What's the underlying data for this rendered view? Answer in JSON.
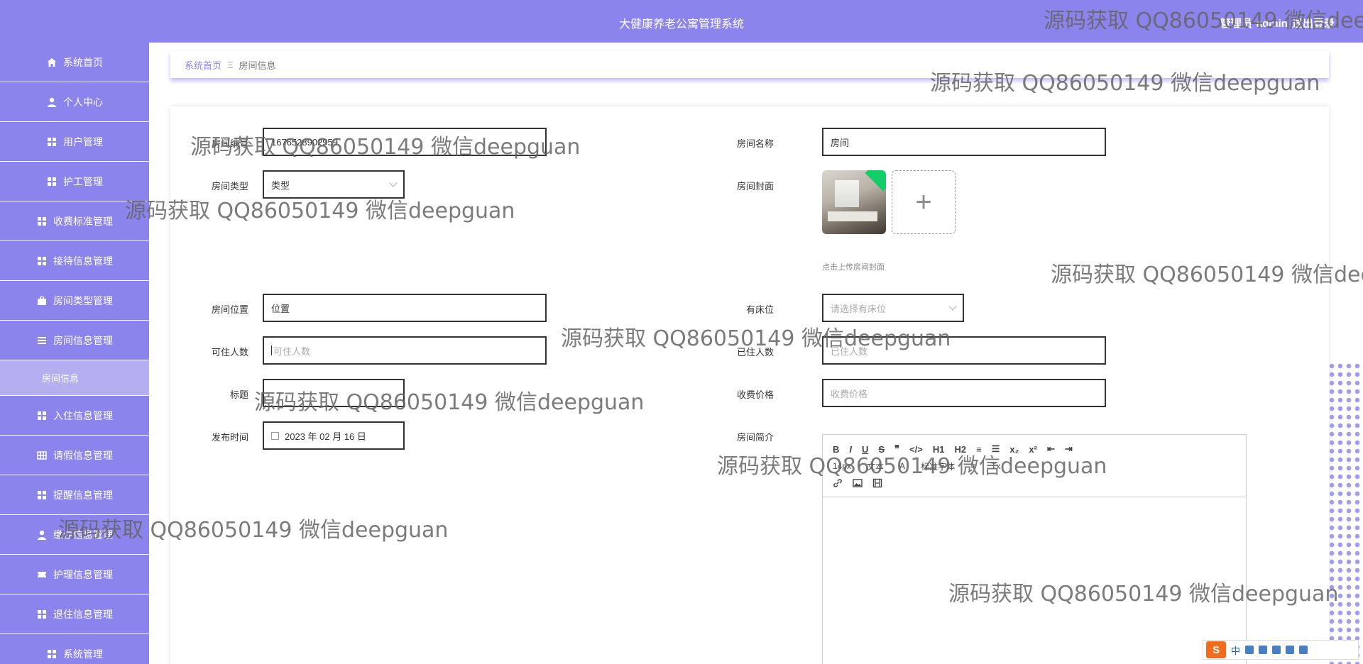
{
  "header": {
    "title": "大健康养老公寓管理系统",
    "user_role": "管理员",
    "user_name": "admin",
    "logout_label": "退出登录"
  },
  "sidebar": {
    "items": [
      {
        "label": "系统首页",
        "icon": "home-icon"
      },
      {
        "label": "个人中心",
        "icon": "user-icon"
      },
      {
        "label": "用户管理",
        "icon": "grid-icon"
      },
      {
        "label": "护工管理",
        "icon": "grid-icon"
      },
      {
        "label": "收费标准管理",
        "icon": "grid-icon"
      },
      {
        "label": "接待信息管理",
        "icon": "grid-icon"
      },
      {
        "label": "房间类型管理",
        "icon": "briefcase-icon"
      },
      {
        "label": "房间信息管理",
        "icon": "menu-icon"
      },
      {
        "label": "房间信息",
        "icon": ""
      },
      {
        "label": "入住信息管理",
        "icon": "grid-icon"
      },
      {
        "label": "请假信息管理",
        "icon": "table-icon"
      },
      {
        "label": "提醒信息管理",
        "icon": "grid-icon"
      },
      {
        "label": "缴住信息管理",
        "icon": "user-icon"
      },
      {
        "label": "护理信息管理",
        "icon": "ticket-icon"
      },
      {
        "label": "退住信息管理",
        "icon": "grid-icon"
      },
      {
        "label": "系统管理",
        "icon": "grid-icon"
      }
    ]
  },
  "breadcrumb": {
    "home": "系统首页",
    "separator": "Ξ",
    "current": "房间信息"
  },
  "form": {
    "room_no_label": "房间编号",
    "room_no_value": "1676528902959",
    "room_name_label": "房间名称",
    "room_name_value": "房间",
    "room_type_label": "房间类型",
    "room_type_value": "类型",
    "cover_label": "房间封面",
    "cover_hint": "点击上传房间封面",
    "upload_plus": "+",
    "location_label": "房间位置",
    "location_value": "位置",
    "bed_label": "有床位",
    "bed_placeholder": "请选择有床位",
    "capacity_label": "可住人数",
    "capacity_placeholder": "可住人数",
    "occupied_label": "已住人数",
    "occupied_placeholder": "已住人数",
    "title_label": "标题",
    "price_label": "收费价格",
    "price_placeholder": "收费价格",
    "publish_label": "发布时间",
    "publish_value": "2023 年 02 月 16 日",
    "intro_label": "房间简介"
  },
  "editor": {
    "row1": [
      "B",
      "I",
      "U",
      "S",
      "❞",
      "</>",
      "H1",
      "H2",
      "≡",
      "☰",
      "x₂",
      "x²",
      "⇤",
      "⇥"
    ],
    "font_size": "14px",
    "text_style": "文本",
    "font_family": "标准字体",
    "clear_format": "Tx"
  },
  "watermark_text": "源码获取 QQ86050149 微信deepguan",
  "ime": {
    "lang": "中"
  },
  "colors": {
    "primary": "#8c84ed",
    "sub_active": "#b3aff0",
    "success_badge": "#13ce66"
  }
}
